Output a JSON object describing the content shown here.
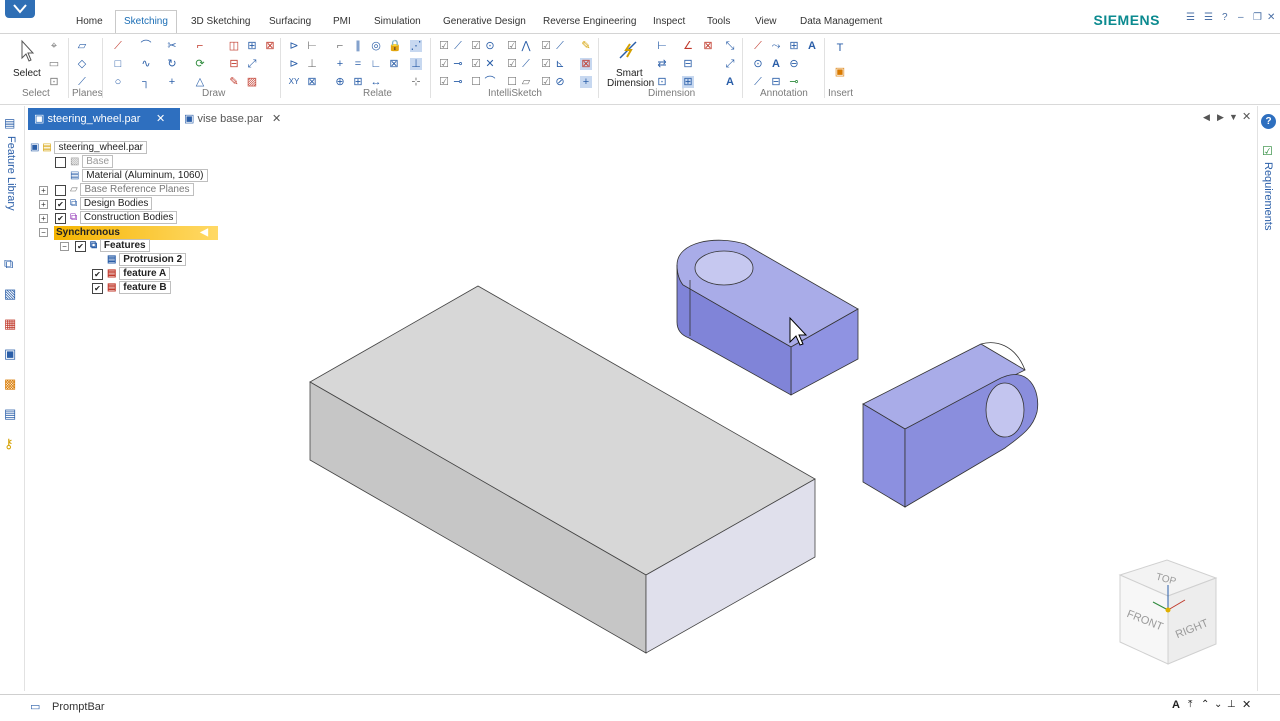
{
  "ribbon_tabs": [
    "Home",
    "Sketching",
    "3D Sketching",
    "Surfacing",
    "PMI",
    "Simulation",
    "Generative Design",
    "Reverse Engineering",
    "Inspect",
    "Tools",
    "View",
    "Data Management"
  ],
  "active_tab": "Sketching",
  "brand": "SIEMENS",
  "groups": {
    "select": "Select",
    "select_button": "Select",
    "planes": "Planes",
    "draw": "Draw",
    "relate": "Relate",
    "intellisketch": "IntelliSketch",
    "dimension": "Dimension",
    "smart_dimension_line1": "Smart",
    "smart_dimension_line2": "Dimension",
    "annotation": "Annotation",
    "insert": "Insert"
  },
  "doc_tabs": [
    {
      "label": "steering_wheel.par",
      "active": true
    },
    {
      "label": "vise base.par",
      "active": false
    }
  ],
  "left_rail": {
    "feature_library": "Feature Library"
  },
  "right_rail": {
    "requirements": "Requirements"
  },
  "tree": {
    "root": "steering_wheel.par",
    "base": "Base",
    "material": "Material (Aluminum, 1060)",
    "base_ref_planes": "Base Reference Planes",
    "design_bodies": "Design Bodies",
    "construction_bodies": "Construction Bodies",
    "synchronous": "Synchronous",
    "features": "Features",
    "protrusion": "Protrusion 2",
    "feature_a": "feature A",
    "feature_b": "feature B"
  },
  "viewcube": {
    "top": "TOP",
    "front": "FRONT",
    "right": "RIGHT"
  },
  "prompt_bar": "PromptBar",
  "colors": {
    "accent": "#2e6fbf",
    "body_blue": "#9aa0e8",
    "body_gray": "#c9c9c9",
    "brand": "#0b8a8f",
    "synchronous": "#f5b400"
  }
}
